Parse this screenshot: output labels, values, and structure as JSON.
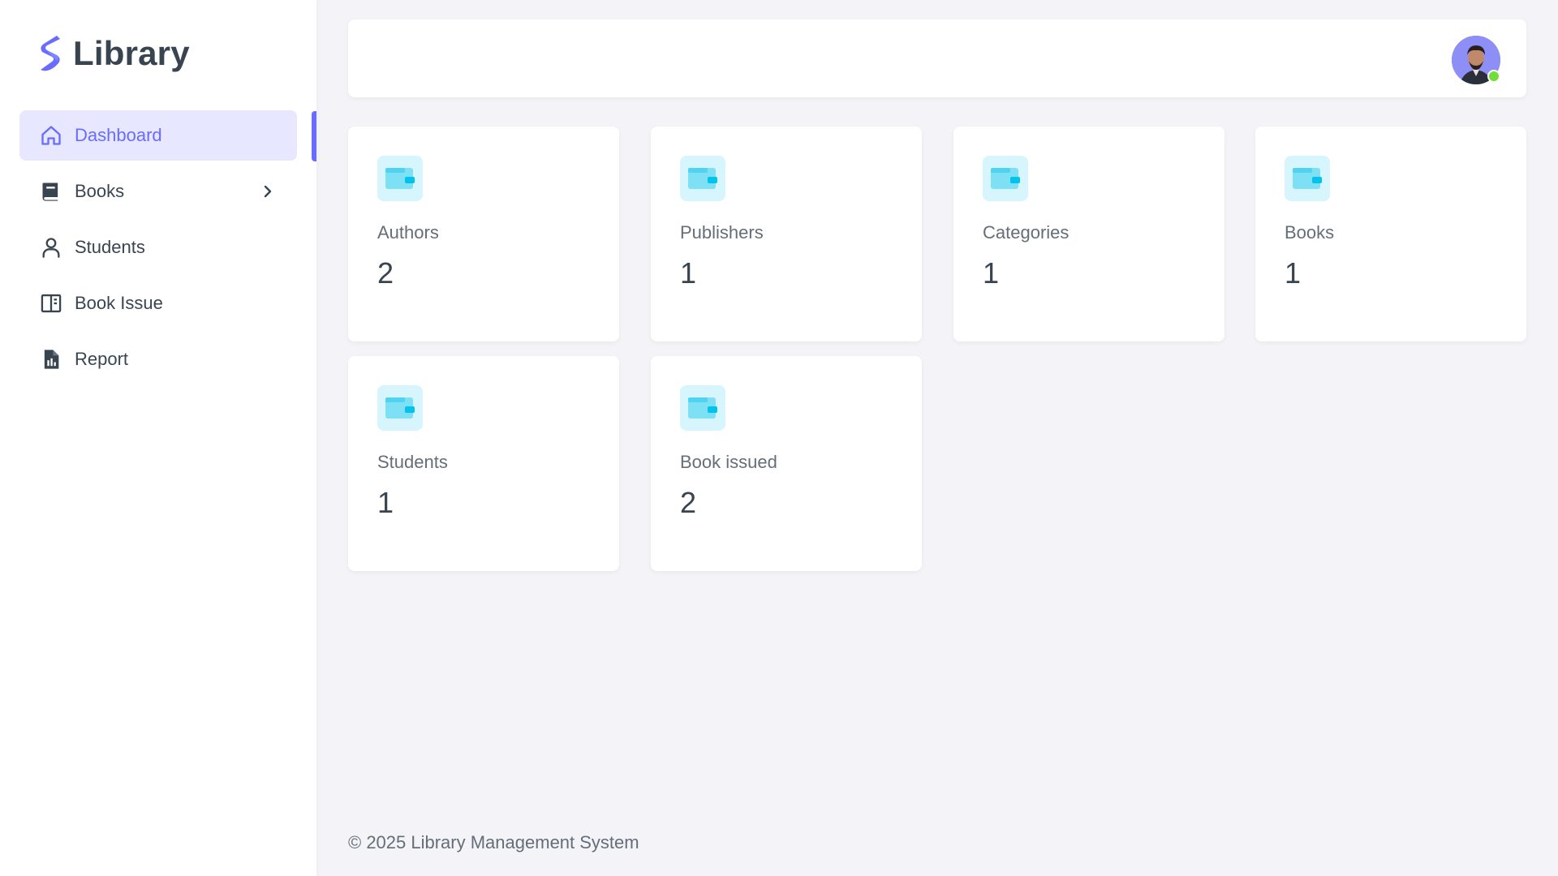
{
  "brand": {
    "name": "Library",
    "icon": "brand-logo-icon",
    "accent": "#696cff"
  },
  "sidebar": {
    "items": [
      {
        "label": "Dashboard",
        "icon": "home-icon",
        "active": true
      },
      {
        "label": "Books",
        "icon": "book-icon",
        "has_submenu": true
      },
      {
        "label": "Students",
        "icon": "user-icon"
      },
      {
        "label": "Book Issue",
        "icon": "columns-icon"
      },
      {
        "label": "Report",
        "icon": "file-chart-icon"
      }
    ]
  },
  "topbar": {
    "avatar": "user-avatar",
    "status": "online",
    "status_color": "#71dd37"
  },
  "cards": [
    {
      "label": "Authors",
      "value": "2",
      "icon": "wallet-icon"
    },
    {
      "label": "Publishers",
      "value": "1",
      "icon": "wallet-icon"
    },
    {
      "label": "Categories",
      "value": "1",
      "icon": "wallet-icon"
    },
    {
      "label": "Books",
      "value": "1",
      "icon": "wallet-icon"
    },
    {
      "label": "Students",
      "value": "1",
      "icon": "wallet-icon"
    },
    {
      "label": "Book issued",
      "value": "2",
      "icon": "wallet-icon"
    }
  ],
  "footer": {
    "text": "© 2025 Library Management System"
  }
}
